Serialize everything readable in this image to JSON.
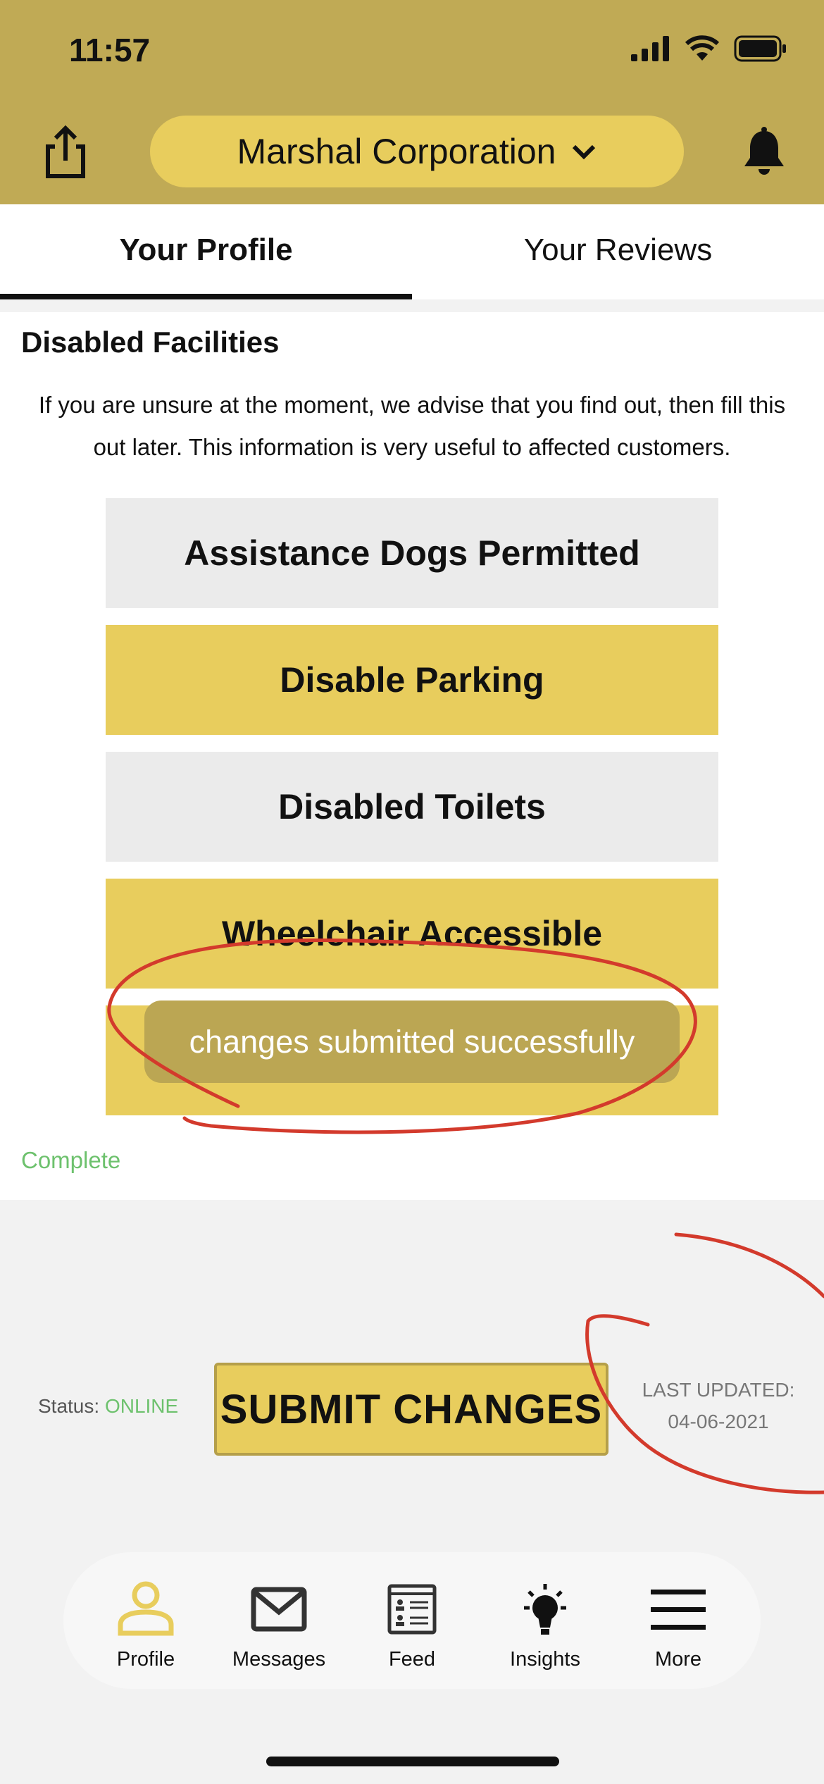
{
  "status_bar": {
    "time": "11:57"
  },
  "header": {
    "company": "Marshal Corporation",
    "share_icon": "share-icon",
    "bell_icon": "bell-icon",
    "dropdown_icon": "chevron-down-icon"
  },
  "tabs": [
    {
      "label": "Your Profile",
      "active": true
    },
    {
      "label": "Your Reviews",
      "active": false
    }
  ],
  "section": {
    "title": "Disabled Facilities",
    "intro": "If you are unsure at the moment, we advise that you find out, then fill this out later. This information is very useful to affected customers.",
    "options": [
      {
        "label": "Assistance Dogs Permitted",
        "selected": false
      },
      {
        "label": "Disable Parking",
        "selected": true
      },
      {
        "label": "Disabled Toilets",
        "selected": false
      },
      {
        "label": "Wheelchair Accessible",
        "selected": true
      },
      {
        "label": "",
        "selected": true
      }
    ],
    "toast": "changes submitted successfully",
    "completion": "Complete"
  },
  "footer": {
    "status_label": "Status:",
    "status_value": "ONLINE",
    "submit_label": "SUBMIT CHANGES",
    "last_updated_label": "LAST UPDATED:",
    "last_updated_date": "04-06-2021"
  },
  "nav": [
    {
      "label": "Profile",
      "icon": "profile-icon"
    },
    {
      "label": "Messages",
      "icon": "mail-icon"
    },
    {
      "label": "Feed",
      "icon": "feed-icon"
    },
    {
      "label": "Insights",
      "icon": "lightbulb-icon"
    },
    {
      "label": "More",
      "icon": "menu-icon"
    }
  ],
  "colors": {
    "header_bg": "#c0aa55",
    "accent_yellow": "#e8cd5d",
    "unselected_grey": "#ebebeb",
    "online_green": "#6dc16d",
    "annotation_red": "#d33a2c"
  }
}
